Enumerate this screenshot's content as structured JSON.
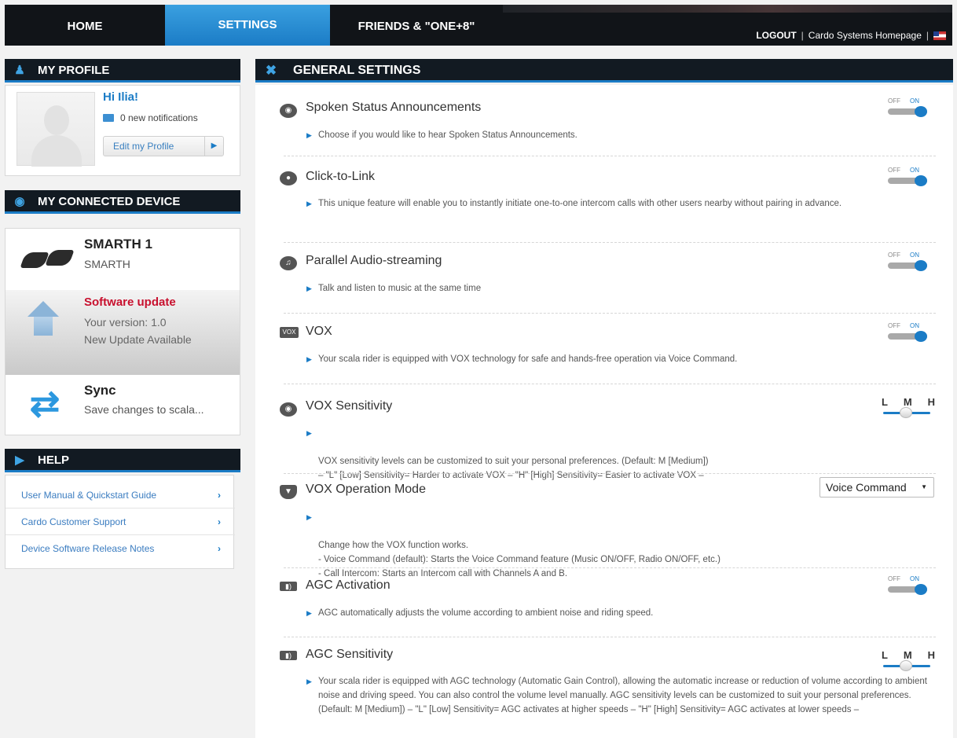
{
  "nav": {
    "tabs": [
      "HOME",
      "SETTINGS",
      "FRIENDS & \"ONE+8\""
    ],
    "logout": "LOGOUT",
    "separator": "|",
    "homepage_link": "Cardo Systems Homepage"
  },
  "profile": {
    "header": "MY PROFILE",
    "greeting": "Hi Ilia!",
    "notifications": "0 new notifications",
    "edit_label": "Edit my Profile"
  },
  "device": {
    "header": "MY CONNECTED DEVICE",
    "name": "SMARTH 1",
    "model": "SMARTH",
    "update_title": "Software update",
    "version": "Your version: 1.0",
    "update_status": "New Update Available",
    "sync_title": "Sync",
    "sync_sub": "Save changes to scala..."
  },
  "help": {
    "header": "HELP",
    "items": [
      "User Manual & Quickstart Guide",
      "Cardo Customer Support",
      "Device Software Release Notes"
    ]
  },
  "general": {
    "header": "GENERAL SETTINGS",
    "off_label": "OFF",
    "on_label": "ON",
    "lmh": [
      "L",
      "M",
      "H"
    ],
    "settings": [
      {
        "title": "Spoken Status Announcements",
        "desc": "Choose if you would like to hear Spoken Status Announcements.",
        "control": "toggle",
        "value": "ON"
      },
      {
        "title": "Click-to-Link",
        "desc": "This unique feature will enable you to instantly initiate one-to-one intercom calls with other users nearby without pairing in advance.",
        "control": "toggle",
        "value": "ON"
      },
      {
        "title": "Parallel Audio-streaming",
        "desc": "Talk and listen to music at the same time",
        "control": "toggle",
        "value": "ON"
      },
      {
        "title": "VOX",
        "desc": "Your scala rider is equipped with VOX technology for safe and hands-free operation via Voice Command.",
        "control": "toggle",
        "value": "ON"
      },
      {
        "title": "VOX Sensitivity",
        "desc": "VOX sensitivity levels can be customized to suit your personal preferences. (Default: M [Medium])\n– \"L\" [Low] Sensitivity= Harder to activate VOX – \"H\" [High] Sensitivity= Easier to activate VOX –",
        "control": "lmh",
        "value": "M"
      },
      {
        "title": "VOX Operation Mode",
        "desc": "Change how the VOX function works.\n- Voice Command (default): Starts the Voice Command feature (Music ON/OFF, Radio ON/OFF, etc.)\n- Call Intercom: Starts an Intercom call with Channels A and B.",
        "control": "select",
        "value": "Voice Command"
      },
      {
        "title": "AGC Activation",
        "desc": "AGC automatically adjusts the volume according to ambient noise and riding speed.",
        "control": "toggle",
        "value": "ON"
      },
      {
        "title": "AGC Sensitivity",
        "desc": "Your scala rider is equipped with AGC technology (Automatic Gain Control), allowing the automatic increase or reduction of volume according to ambient noise and driving speed. You can also control the volume level manually. AGC sensitivity levels can be customized to suit your personal preferences. (Default: M [Medium]) – \"L\" [Low] Sensitivity= AGC activates at higher speeds – \"H\" [High] Sensitivity= AGC activates at lower speeds –",
        "control": "lmh",
        "value": "M"
      }
    ]
  },
  "colors": {
    "accent": "#1b7cc6",
    "header_bg": "#121a22",
    "update_red": "#c8102e"
  }
}
